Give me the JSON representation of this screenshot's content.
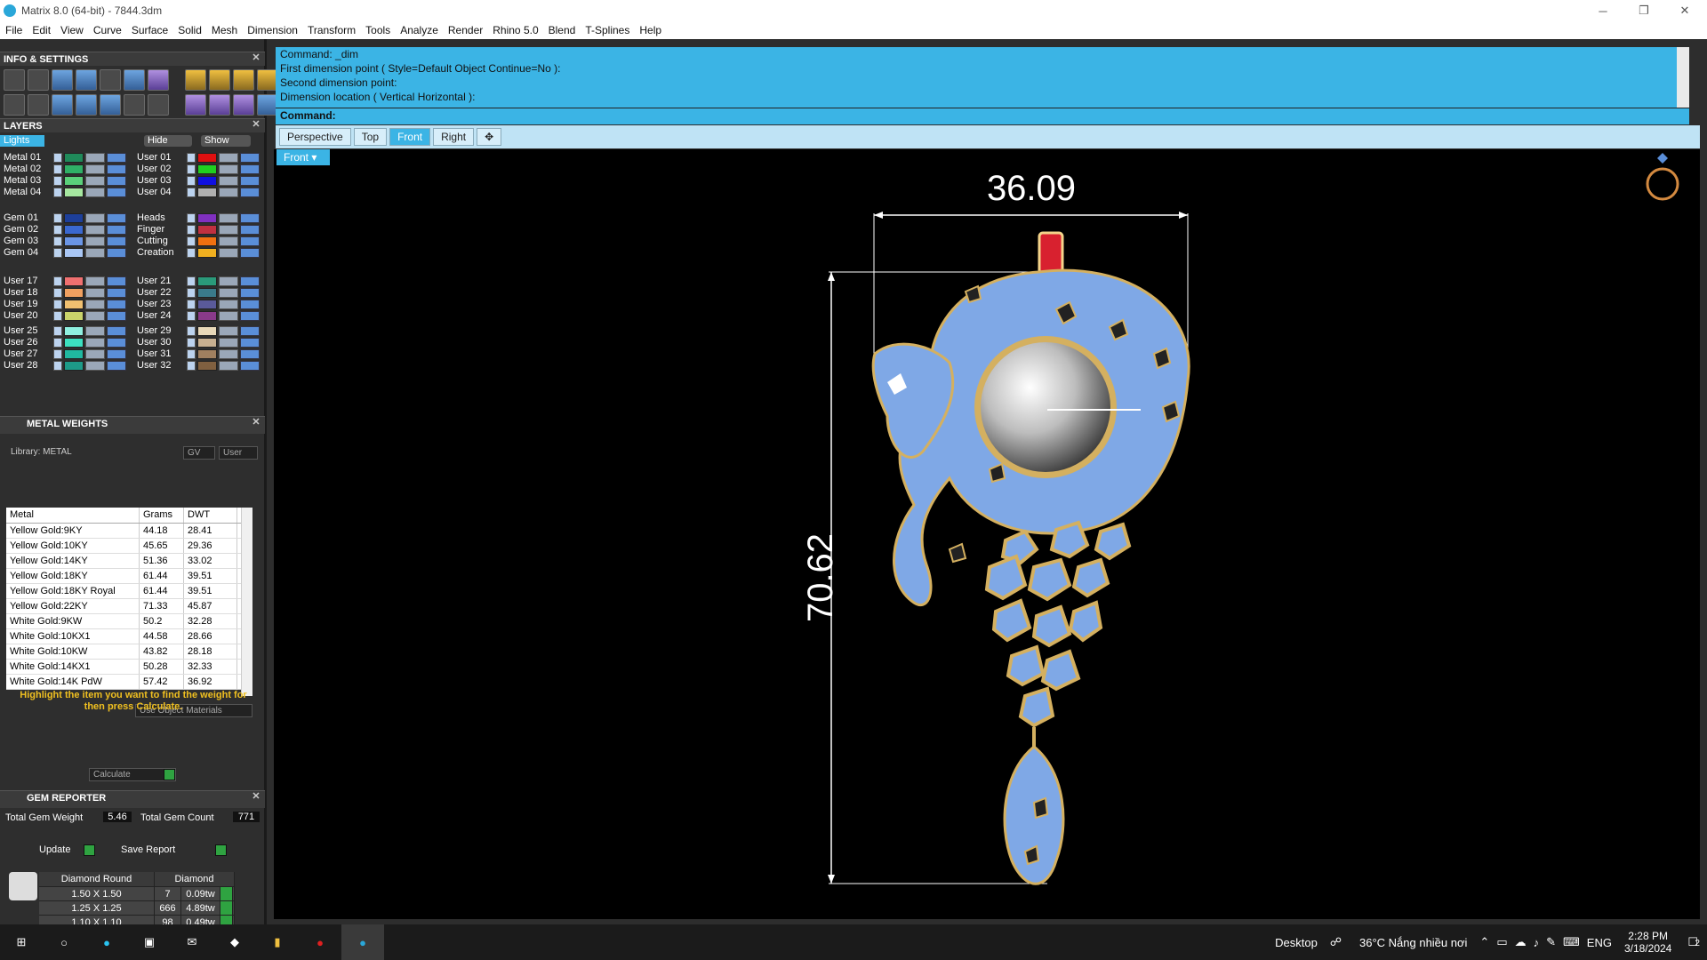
{
  "window": {
    "title": "Matrix 8.0 (64-bit) - 7844.3dm",
    "minimize": "─",
    "maximize": "❐",
    "close": "✕"
  },
  "menu": [
    "File",
    "Edit",
    "View",
    "Curve",
    "Surface",
    "Solid",
    "Mesh",
    "Dimension",
    "Transform",
    "Tools",
    "Analyze",
    "Render",
    "Rhino 5.0",
    "Blend",
    "T-Splines",
    "Help"
  ],
  "info_settings": {
    "title": "INFO & SETTINGS"
  },
  "layers": {
    "title": "LAYERS",
    "lights": "Lights",
    "hide": "Hide",
    "show": "Show",
    "left": [
      {
        "name": "Metal 01",
        "color": "#1f8a5a"
      },
      {
        "name": "Metal 02",
        "color": "#2fb066"
      },
      {
        "name": "Metal 03",
        "color": "#5ad07a"
      },
      {
        "name": "Metal 04",
        "color": "#a6e7a0"
      },
      {
        "name": "Gem 01",
        "color": "#1d3f9a"
      },
      {
        "name": "Gem 02",
        "color": "#3a68d0"
      },
      {
        "name": "Gem 03",
        "color": "#6a95e6"
      },
      {
        "name": "Gem 04",
        "color": "#a9c6f4"
      },
      {
        "name": "User 17",
        "color": "#f07070"
      },
      {
        "name": "User 18",
        "color": "#f0a060"
      },
      {
        "name": "User 19",
        "color": "#f0c070"
      },
      {
        "name": "User 20",
        "color": "#c9d36a"
      },
      {
        "name": "User 25",
        "color": "#8ff0e0"
      },
      {
        "name": "User 26",
        "color": "#3ce0c0"
      },
      {
        "name": "User 27",
        "color": "#20b8a0"
      },
      {
        "name": "User 28",
        "color": "#1d9a88"
      }
    ],
    "right": [
      {
        "name": "User 01",
        "color": "#e01010"
      },
      {
        "name": "User 02",
        "color": "#20d020"
      },
      {
        "name": "User 03",
        "color": "#1010e0"
      },
      {
        "name": "User 04",
        "color": "#b0b0b0"
      },
      {
        "name": "Heads",
        "color": "#8030c0"
      },
      {
        "name": "Finger",
        "color": "#c03040"
      },
      {
        "name": "Cutting",
        "color": "#f07010"
      },
      {
        "name": "Creation",
        "color": "#f0b020"
      },
      {
        "name": "User 21",
        "color": "#2a9a7a"
      },
      {
        "name": "User 22",
        "color": "#3a7a8a"
      },
      {
        "name": "User 23",
        "color": "#5a5a9a"
      },
      {
        "name": "User 24",
        "color": "#8a3a8a"
      },
      {
        "name": "User 29",
        "color": "#e8d8b8"
      },
      {
        "name": "User 30",
        "color": "#c8b090"
      },
      {
        "name": "User 31",
        "color": "#a08060"
      },
      {
        "name": "User 32",
        "color": "#806040"
      }
    ]
  },
  "metal_weights": {
    "title": "METAL WEIGHTS",
    "library": "Library: METAL",
    "gv": "GV",
    "user": "User",
    "columns": [
      "Metal",
      "Grams",
      "DWT"
    ],
    "rows": [
      [
        "Yellow Gold:9KY",
        "44.18",
        "28.41"
      ],
      [
        "Yellow Gold:10KY",
        "45.65",
        "29.36"
      ],
      [
        "Yellow Gold:14KY",
        "51.36",
        "33.02"
      ],
      [
        "Yellow Gold:18KY",
        "61.44",
        "39.51"
      ],
      [
        "Yellow Gold:18KY Royal",
        "61.44",
        "39.51"
      ],
      [
        "Yellow Gold:22KY",
        "71.33",
        "45.87"
      ],
      [
        "White Gold:9KW",
        "50.2",
        "32.28"
      ],
      [
        "White Gold:10KX1",
        "44.58",
        "28.66"
      ],
      [
        "White Gold:10KW",
        "43.82",
        "28.18"
      ],
      [
        "White Gold:14KX1",
        "50.28",
        "32.33"
      ],
      [
        "White Gold:14K PdW",
        "57.42",
        "36.92"
      ]
    ],
    "use_object_materials": "Use Object Materials",
    "hint": "Highlight the item you want to find the weight for then press Calculate.",
    "calculate": "Calculate"
  },
  "gem_reporter": {
    "title": "GEM REPORTER",
    "total_weight_label": "Total Gem Weight",
    "total_weight": "5.46",
    "total_count_label": "Total Gem Count",
    "total_count": "771",
    "update": "Update",
    "save_report": "Save Report",
    "headers": [
      "Diamond Round",
      "Diamond"
    ],
    "rows": [
      [
        "1.50 X 1.50",
        "7",
        "0.09tw"
      ],
      [
        "1.25 X 1.25",
        "666",
        "4.89tw"
      ],
      [
        "1.10 X 1.10",
        "98",
        "0.49tw"
      ]
    ]
  },
  "command": {
    "lines": [
      "Command: _dim",
      "First dimension point ( Style=Default  Object  Continue=No ):",
      "Second dimension point:",
      "Dimension location ( Vertical  Horizontal ):"
    ],
    "prompt": "Command:"
  },
  "viewport_tabs": [
    "Perspective",
    "Top",
    "Front",
    "Right",
    "✥"
  ],
  "viewport": {
    "label": "Front",
    "dimension_width": "36.09",
    "dimension_height": "70.62"
  },
  "taskbar": {
    "desktop": "Desktop",
    "weather": "36°C  Nắng nhiều nơi",
    "language": "ENG",
    "time": "2:28 PM",
    "date": "3/18/2024",
    "notifications": "2"
  }
}
